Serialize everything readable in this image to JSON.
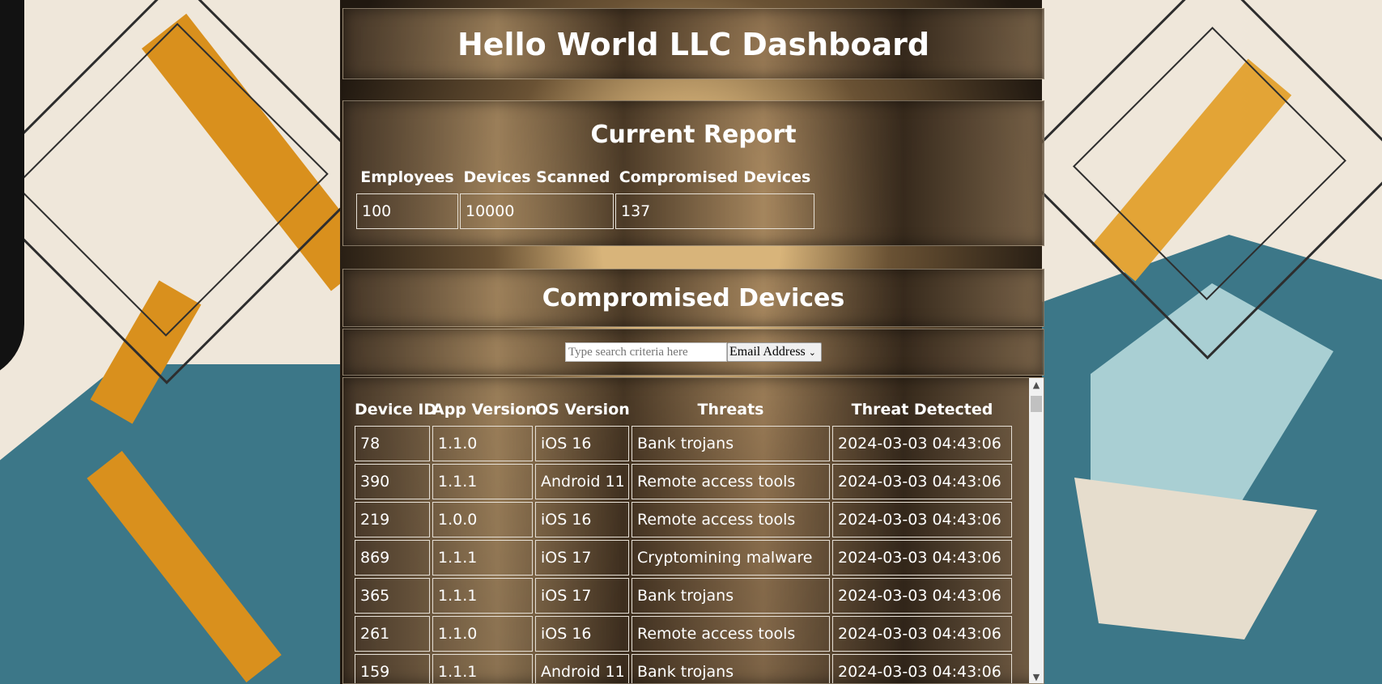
{
  "header": {
    "title": "Hello World LLC Dashboard"
  },
  "report": {
    "title": "Current Report",
    "columns": [
      "Employees",
      "Devices Scanned",
      "Compromised Devices"
    ],
    "values": [
      "100",
      "10000",
      "137"
    ]
  },
  "devices": {
    "title": "Compromised Devices",
    "search_placeholder": "Type search criteria here",
    "search_field": "Email Address",
    "columns": [
      "Device ID",
      "App Version",
      "OS Version",
      "Threats",
      "Threat Detected"
    ],
    "rows": [
      [
        "78",
        "1.1.0",
        "iOS 16",
        "Bank trojans",
        "2024-03-03 04:43:06"
      ],
      [
        "390",
        "1.1.1",
        "Android 11",
        "Remote access tools",
        "2024-03-03 04:43:06"
      ],
      [
        "219",
        "1.0.0",
        "iOS 16",
        "Remote access tools",
        "2024-03-03 04:43:06"
      ],
      [
        "869",
        "1.1.1",
        "iOS 17",
        "Cryptomining malware",
        "2024-03-03 04:43:06"
      ],
      [
        "365",
        "1.1.1",
        "iOS 17",
        "Bank trojans",
        "2024-03-03 04:43:06"
      ],
      [
        "261",
        "1.1.0",
        "iOS 16",
        "Remote access tools",
        "2024-03-03 04:43:06"
      ],
      [
        "159",
        "1.1.1",
        "Android 11",
        "Bank trojans",
        "2024-03-03 04:43:06"
      ]
    ]
  }
}
